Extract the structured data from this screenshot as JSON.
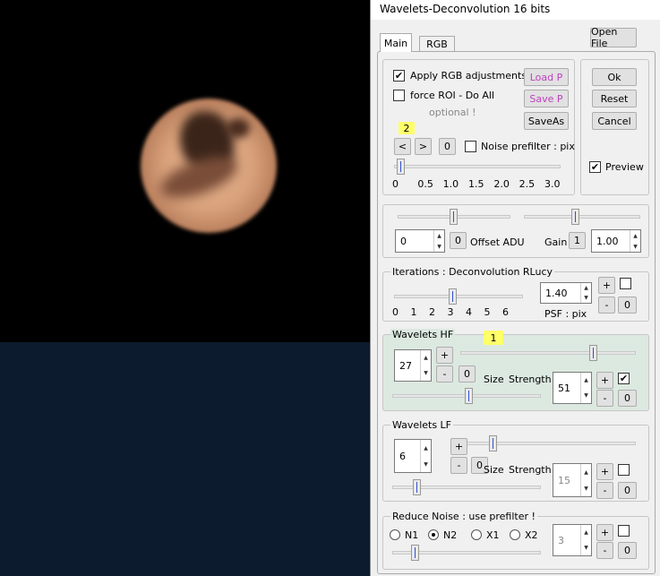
{
  "window": {
    "title": "Wavelets-Deconvolution 16 bits"
  },
  "tabs": [
    {
      "label": "Main"
    },
    {
      "label": "RGB"
    }
  ],
  "toolbar": {
    "open_file": "Open File"
  },
  "main": {
    "apply_rgb": "Apply RGB adjustments",
    "force_roi": "force ROI - Do All",
    "optional": "optional !",
    "load_p": "Load P",
    "save_p": "Save P",
    "save_as": "SaveAs",
    "index_badge": "2",
    "prev": "<",
    "next": ">",
    "zero": "0",
    "noise_prefilter": "Noise prefilter : pix",
    "prefilter_ticks": [
      "0",
      "0.5",
      "1.0",
      "1.5",
      "2.0",
      "2.5",
      "3.0"
    ],
    "prefilter_value": 0.1
  },
  "actions": {
    "ok": "Ok",
    "reset": "Reset",
    "cancel": "Cancel",
    "preview": "Preview"
  },
  "offset": {
    "value": "0",
    "zero": "0",
    "label": "Offset ADU",
    "gain_label": "Gain",
    "gain_btn": "1",
    "gain_value": "1.00"
  },
  "iterations": {
    "title": "Iterations : Deconvolution RLucy",
    "ticks": [
      "0",
      "1",
      "2",
      "3",
      "4",
      "5",
      "6"
    ],
    "value": 3,
    "psf_value": "1.40",
    "psf_label": "PSF : pix",
    "plus": "+",
    "minus": "-",
    "zero": "0"
  },
  "hf": {
    "title": "Wavelets HF",
    "badge": "1",
    "size_value": "27",
    "size_label": "Size",
    "strength_label": "Strength",
    "strength_value": "51",
    "plus": "+",
    "minus": "-",
    "zero": "0"
  },
  "lf": {
    "title": "Wavelets LF",
    "size_value": "6",
    "size_label": "Size",
    "strength_label": "Strength",
    "strength_value": "15",
    "plus": "+",
    "minus": "-",
    "zero": "0"
  },
  "noise": {
    "title": "Reduce Noise : use prefilter !",
    "options": [
      "N1",
      "N2",
      "X1",
      "X2"
    ],
    "selected": "N2",
    "value": "3",
    "plus": "+",
    "minus": "-",
    "zero": "0"
  },
  "colors": {
    "panel_hf": "#dce9e0",
    "badge": "#ffff6a",
    "purple": "#c040c0",
    "sky": "#0d1b2e"
  }
}
